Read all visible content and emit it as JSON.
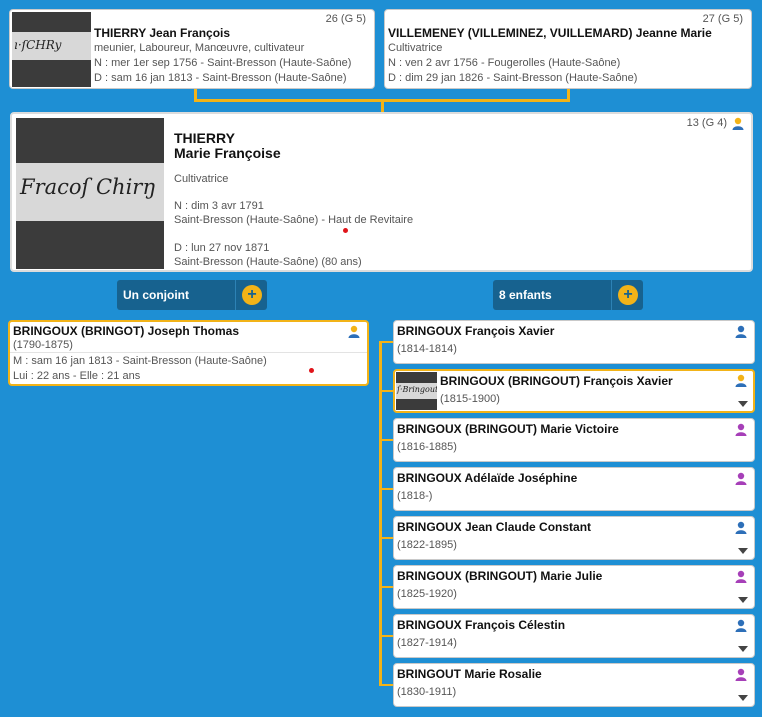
{
  "parents": {
    "father": {
      "number": "26 (G 5)",
      "name": "THIERRY Jean François",
      "occupation": "meunier, Laboureur, Manœuvre, cultivateur",
      "birth": "N : mer 1er sep 1756 - Saint-Bresson (Haute-Saône)",
      "death": "D : sam 16 jan 1813 - Saint-Bresson (Haute-Saône)"
    },
    "mother": {
      "number": "27 (G 5)",
      "name": "VILLEMENEY (VILLEMINEZ, VUILLEMARD) Jeanne Marie",
      "occupation": "Cultivatrice",
      "birth": "N : ven 2 avr 1756 - Fougerolles (Haute-Saône)",
      "death": "D : dim 29 jan 1826 - Saint-Bresson (Haute-Saône)"
    }
  },
  "person": {
    "number": "13 (G 4)",
    "surname": "THIERRY",
    "given": "Marie Françoise",
    "occupation": "Cultivatrice",
    "birth_date": "N : dim 3 avr 1791",
    "birth_place": "Saint-Bresson (Haute-Saône) - Haut de Revitaire",
    "death_date": "D : lun 27 nov 1871",
    "death_place": "Saint-Bresson (Haute-Saône) (80 ans)"
  },
  "buttons": {
    "spouses_label": "Un conjoint",
    "children_label": "8 enfants",
    "plus": "+"
  },
  "spouse": {
    "name": "BRINGOUX (BRINGOT) Joseph Thomas",
    "dates": "(1790-1875)",
    "marriage": "M : sam 16 jan 1813 - Saint-Bresson (Haute-Saône)",
    "ages": "Lui : 22 ans - Elle : 21 ans"
  },
  "children": [
    {
      "name": "BRINGOUX François Xavier",
      "dates": "(1814-1814)",
      "sex": "male",
      "has_dropdown": false
    },
    {
      "name": "BRINGOUX (BRINGOUT) François Xavier",
      "dates": "(1815-1900)",
      "sex": "unknown",
      "has_dropdown": true,
      "has_photo": true
    },
    {
      "name": "BRINGOUX (BRINGOUT) Marie Victoire",
      "dates": "(1816-1885)",
      "sex": "female",
      "has_dropdown": false
    },
    {
      "name": "BRINGOUX Adélaïde Joséphine",
      "dates": "(1818-)",
      "sex": "female",
      "has_dropdown": false
    },
    {
      "name": "BRINGOUX Jean Claude Constant",
      "dates": "(1822-1895)",
      "sex": "male",
      "has_dropdown": true
    },
    {
      "name": "BRINGOUX (BRINGOUT) Marie Julie",
      "dates": "(1825-1920)",
      "sex": "female",
      "has_dropdown": true
    },
    {
      "name": "BRINGOUX François Célestin",
      "dates": "(1827-1914)",
      "sex": "male",
      "has_dropdown": true
    },
    {
      "name": "BRINGOUT Marie Rosalie",
      "dates": "(1830-1911)",
      "sex": "female",
      "has_dropdown": true
    }
  ],
  "colors": {
    "background": "#1e8fd4",
    "accent": "#f2b318",
    "button": "#17628f",
    "male_icon": "#2d6fb8",
    "female_icon": "#a63fb8",
    "unknown_icon": "#f2b318"
  },
  "icons": {
    "person": "person-silhouette-icon",
    "dropdown": "chevron-down-icon",
    "add": "plus-circle-icon"
  }
}
